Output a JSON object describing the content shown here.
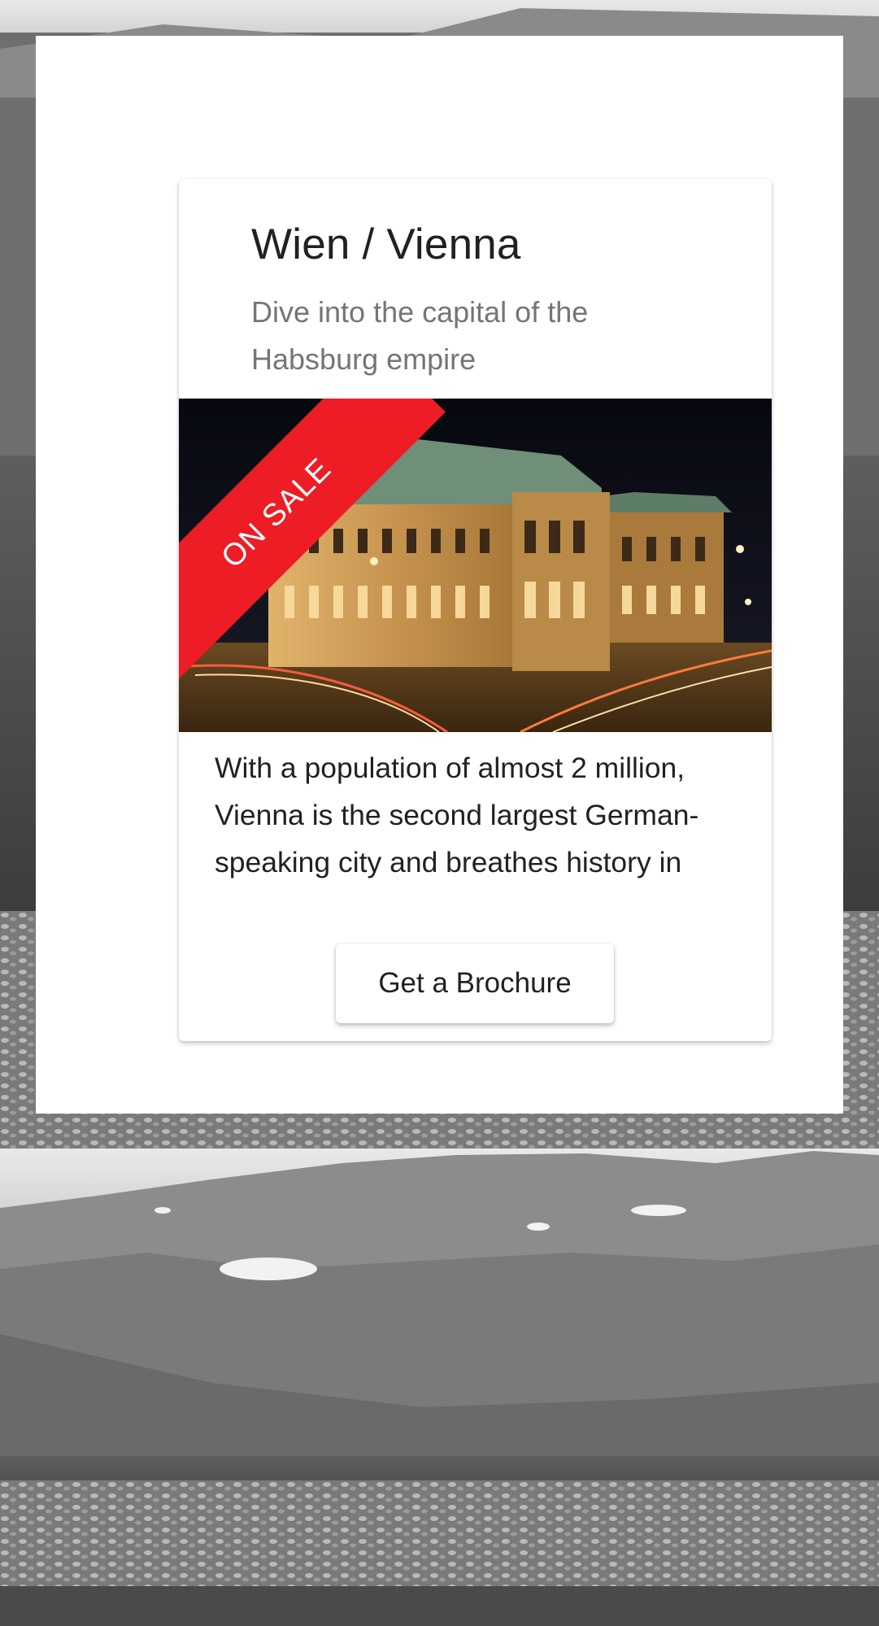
{
  "card": {
    "title": "Wien / Vienna",
    "subtitle": "Dive into the capital of the Habsburg empire",
    "ribbon": "ON SALE",
    "text": "With a population of almost 2 million, Vienna is the second largest German-speaking city and breathes history in every street corner.",
    "button_label": "Get a Brochure"
  },
  "colors": {
    "ribbon": "#ee1c25",
    "title": "#212121",
    "subtitle": "#757575"
  },
  "images": {
    "background": "grayscale-mountain-lake-landscape",
    "card_media": "vienna-state-opera-night-photo"
  }
}
